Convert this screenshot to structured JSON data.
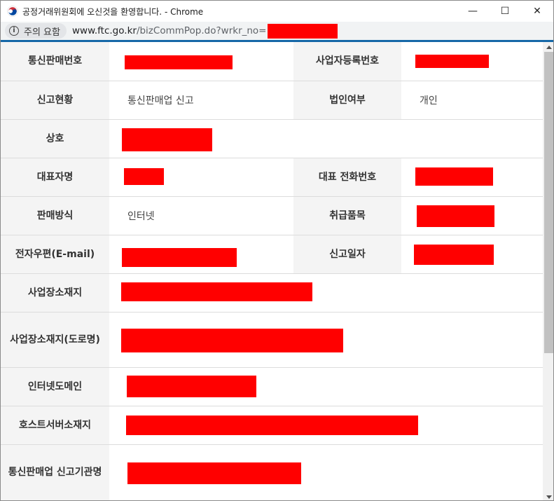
{
  "window": {
    "title": "공정거래위원회에 오신것을 환영합니다. - Chrome",
    "controls": {
      "minimize": "—",
      "maximize": "☐",
      "close": "✕"
    }
  },
  "address_bar": {
    "security_label": "주의 요함",
    "url_host": "www.ftc.go.kr",
    "url_path": "/bizCommPop.do?wrkr_no="
  },
  "table": {
    "rows": [
      {
        "label": "통신판매번호",
        "label2": "사업자등록번호"
      },
      {
        "label": "신고현황",
        "value": "통신판매업 신고",
        "label2": "법인여부",
        "value2": "개인"
      },
      {
        "label": "상호"
      },
      {
        "label": "대표자명",
        "label2": "대표 전화번호"
      },
      {
        "label": "판매방식",
        "value": "인터넷",
        "label2": "취급품목"
      },
      {
        "label": "전자우편(E-mail)",
        "label2": "신고일자"
      },
      {
        "label": "사업장소재지"
      },
      {
        "label": "사업장소재지(도로명)"
      },
      {
        "label": "인터넷도메인"
      },
      {
        "label": "호스트서버소재지"
      },
      {
        "label": "통신판매업 신고기관명"
      }
    ]
  },
  "colors": {
    "accent": "#1668a8",
    "redaction": "#ff0000",
    "label_bg": "#f4f4f4"
  }
}
